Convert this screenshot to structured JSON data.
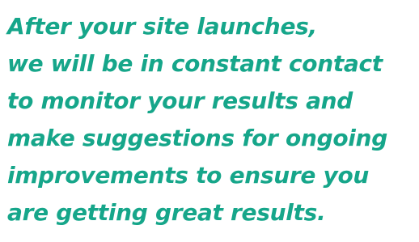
{
  "colors": {
    "text": "#16a68a",
    "background": "#ffffff"
  },
  "content": {
    "lines": [
      "After your site launches,",
      "we will be in constant contact",
      "to monitor your results and",
      "make suggestions for ongoing",
      "improvements to ensure you",
      "are getting great results."
    ]
  }
}
